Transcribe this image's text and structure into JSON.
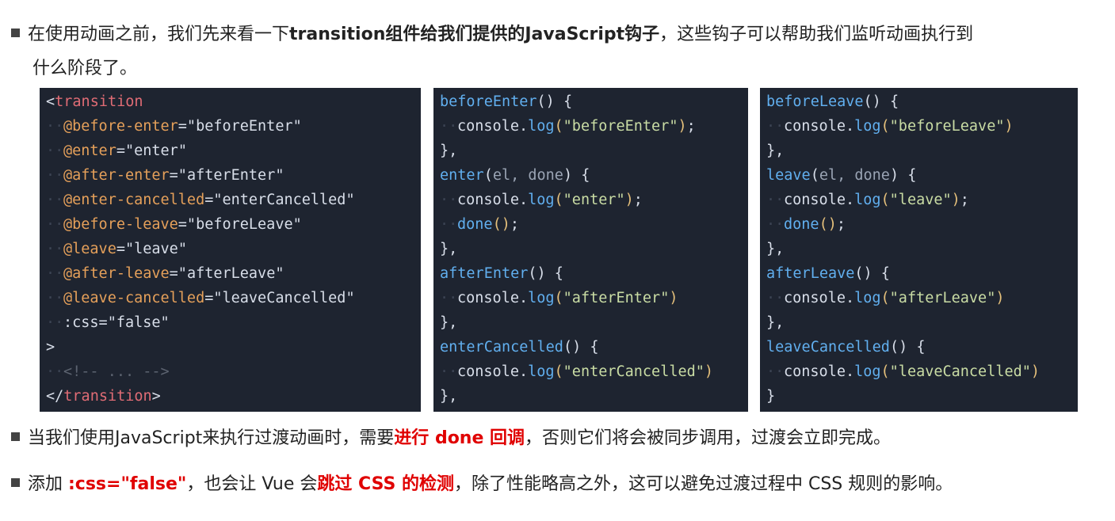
{
  "bullet1": {
    "part1": "在使用动画之前，我们先来看一下",
    "bold": "transition组件给我们提供的JavaScript钩子",
    "part2": "，这些钩子可以帮助我们监听动画执行到",
    "line2": "什么阶段了。"
  },
  "code1": {
    "open_tag": "transition",
    "attrs": [
      {
        "name": "before-enter",
        "value": "beforeEnter"
      },
      {
        "name": "enter",
        "value": "enter"
      },
      {
        "name": "after-enter",
        "value": "afterEnter"
      },
      {
        "name": "enter-cancelled",
        "value": "enterCancelled"
      },
      {
        "name": "before-leave",
        "value": "beforeLeave"
      },
      {
        "name": "leave",
        "value": "leave"
      },
      {
        "name": "after-leave",
        "value": "afterLeave"
      },
      {
        "name": "leave-cancelled",
        "value": "leaveCancelled"
      }
    ],
    "css_line": ":css=\"false\"",
    "close_bracket": ">",
    "comment": "<!-- ... -->",
    "close_tag": "transition"
  },
  "code2": {
    "beforeEnter_name": "beforeEnter",
    "beforeEnter_log": "\"beforeEnter\"",
    "enter_name": "enter",
    "enter_params": "el, done",
    "enter_log": "\"enter\"",
    "done": "done",
    "afterEnter_name": "afterEnter",
    "afterEnter_log": "\"afterEnter\"",
    "enterCancelled_name": "enterCancelled",
    "enterCancelled_log": "\"enterCancelled\""
  },
  "code3": {
    "beforeLeave_name": "beforeLeave",
    "beforeLeave_log": "\"beforeLeave\"",
    "leave_name": "leave",
    "leave_params": "el, done",
    "leave_log": "\"leave\"",
    "done": "done",
    "afterLeave_name": "afterLeave",
    "afterLeave_log": "\"afterLeave\"",
    "leaveCancelled_name": "leaveCancelled",
    "leaveCancelled_log": "\"leaveCancelled\""
  },
  "tokens": {
    "console": "console",
    "log": "log"
  },
  "bullet2": {
    "part1": "当我们使用JavaScript来执行过渡动画时，需要",
    "red": "进行 done 回调",
    "part2": "，否则它们将会被同步调用，过渡会立即完成。"
  },
  "bullet3": {
    "part1": "添加 ",
    "red1": ":css=\"false\"",
    "part2": "，也会让 Vue 会",
    "red2": "跳过 CSS 的检测",
    "part3": "，除了性能略高之外，这可以避免过渡过程中 CSS 规则的影响。"
  }
}
